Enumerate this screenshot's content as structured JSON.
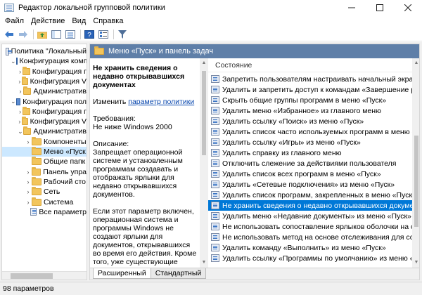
{
  "window": {
    "title": "Редактор локальной групповой политики",
    "minimize_icon": "minimize-icon",
    "maximize_icon": "maximize-icon",
    "close_icon": "close-icon"
  },
  "menu": [
    "Файл",
    "Действие",
    "Вид",
    "Справка"
  ],
  "tree": [
    {
      "label": "Политика \"Локальный",
      "icon": "policy",
      "indent": 0,
      "chevron": ""
    },
    {
      "label": "Конфигурация компь",
      "icon": "computer",
      "indent": 1,
      "chevron": "v"
    },
    {
      "label": "Конфигурация г",
      "icon": "folder",
      "indent": 2,
      "chevron": ">"
    },
    {
      "label": "Конфигурация V",
      "icon": "folder",
      "indent": 2,
      "chevron": ">"
    },
    {
      "label": "Административ",
      "icon": "folder",
      "indent": 2,
      "chevron": ">"
    },
    {
      "label": "Конфигурация пол",
      "icon": "computer",
      "indent": 1,
      "chevron": "v"
    },
    {
      "label": "Конфигурация г",
      "icon": "folder",
      "indent": 2,
      "chevron": ">"
    },
    {
      "label": "Конфигурация V",
      "icon": "folder",
      "indent": 2,
      "chevron": ">"
    },
    {
      "label": "Административ",
      "icon": "folder",
      "indent": 2,
      "chevron": "v"
    },
    {
      "label": "Компоненты",
      "icon": "folder",
      "indent": 3,
      "chevron": ">"
    },
    {
      "label": "Меню «Пуск",
      "icon": "folder",
      "indent": 3,
      "chevron": "",
      "selected": true
    },
    {
      "label": "Общие папк",
      "icon": "folder",
      "indent": 3,
      "chevron": ""
    },
    {
      "label": "Панель упра",
      "icon": "folder",
      "indent": 3,
      "chevron": ">"
    },
    {
      "label": "Рабочий сто",
      "icon": "folder",
      "indent": 3,
      "chevron": ">"
    },
    {
      "label": "Сеть",
      "icon": "folder",
      "indent": 3,
      "chevron": ">"
    },
    {
      "label": "Система",
      "icon": "folder",
      "indent": 3,
      "chevron": ">"
    },
    {
      "label": "Все параметр",
      "icon": "policy",
      "indent": 3,
      "chevron": ""
    }
  ],
  "right_header": "Меню «Пуск» и панель задач",
  "description": {
    "title": "Не хранить сведения о недавно открывавшихся документах",
    "edit_prefix": "Изменить ",
    "edit_link": "параметр политики",
    "requirements_label": "Требования:",
    "requirements_value": "Не ниже Windows 2000",
    "description_label": "Описание:",
    "description_text": "Запрещает операционной системе и установленным программам создавать и отображать ярлыки для недавно открывавшихся документов.",
    "extra_text": "Если этот параметр включен, операционная система и программы Windows не создают ярлыки для документов, открывавшихся во время его действия. Кроме того, уже существующие ярлыки документов сохраняются, но не отображаются. Система очищает меню «Недавние"
  },
  "list_header": "Состояние",
  "settings": [
    {
      "label": "Запретить пользователям настраивать начальный экран"
    },
    {
      "label": "Удалить и запретить доступ к командам «Завершение ра..."
    },
    {
      "label": "Скрыть общие группы программ в меню «Пуск»"
    },
    {
      "label": "Удалить меню «Избранное» из главного меню"
    },
    {
      "label": "Удалить ссылку «Поиск» из меню «Пуск»"
    },
    {
      "label": "Удалить список часто используемых программ в меню «..."
    },
    {
      "label": "Удалить ссылку «Игры» из меню «Пуск»"
    },
    {
      "label": "Удалить справку из главного меню"
    },
    {
      "label": "Отключить слежение за действиями пользователя"
    },
    {
      "label": "Удалить список всех программ в меню «Пуск»"
    },
    {
      "label": "Удалить «Сетевые подключения» из меню «Пуск»"
    },
    {
      "label": "Удалить список программ, закрепленных в меню «Пуск»"
    },
    {
      "label": "Не хранить сведения о недавно открывавшихся докумен...",
      "selected": true
    },
    {
      "label": "Удалить меню «Недавние документы» из меню «Пуск»"
    },
    {
      "label": "Не использовать сопоставление ярлыков оболочки на о..."
    },
    {
      "label": "Не использовать метод на основе отслеживания для соп..."
    },
    {
      "label": "Удалить команду «Выполнить» из меню «Пуск»"
    },
    {
      "label": "Удалить ссылку «Программы по умолчанию» из меню «..."
    }
  ],
  "tabs": [
    {
      "label": "Расширенный",
      "active": true
    },
    {
      "label": "Стандартный",
      "active": false
    }
  ],
  "status": "98 параметров",
  "colors": {
    "selection": "#0078d7",
    "tree_selection": "#cce8ff",
    "header": "#5f7fa8"
  }
}
